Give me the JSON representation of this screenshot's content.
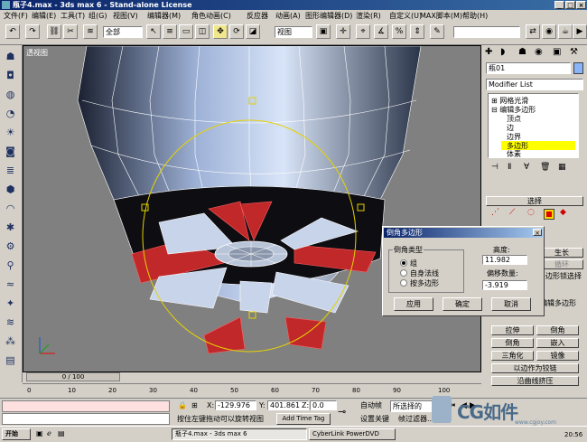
{
  "window": {
    "title": "瓶子4.max - 3ds max 6 - Stand-alone License"
  },
  "menu": [
    "文件(F)",
    "编辑(E)",
    "工具(T)",
    "组(G)",
    "视图(V)",
    "编辑器(M)",
    "角色动画(C)",
    "反应器",
    "动画(A)",
    "图形编辑器(D)",
    "渲染(R)",
    "自定义(U)",
    "MAX脚本(M)",
    "帮助(H)"
  ],
  "toolbar": {
    "selection_filter": "全部",
    "ref_coord": "视图"
  },
  "viewport": {
    "label": "透视图"
  },
  "right_panel": {
    "object_name": "瓶01",
    "modifier_list": "Modifier List",
    "stack": [
      "网格光滑",
      "编辑多边形",
      "顶点",
      "边",
      "边界",
      "多边形",
      "体素"
    ],
    "selected_stack_item": "多边形",
    "rollout_select": "选择",
    "edit_buttons": [
      "生长",
      "循环",
      "多边形锁选择"
    ],
    "bottom_buttons": [
      [
        "拉伸",
        "倒角"
      ],
      [
        "倒角",
        "嵌入"
      ],
      [
        "三角化",
        "镜像"
      ]
    ],
    "hinge_button": "以边作为铰链",
    "spline_button": "沿曲线挤压",
    "partial_label": "编辑多边形",
    "face_label": "多边形"
  },
  "dialog": {
    "title": "倒角多边形",
    "group_label": "倒角类型",
    "options": [
      "组",
      "自身法线",
      "按多边形"
    ],
    "selected_option": "组",
    "height_label": "高度:",
    "height_value": "11.982",
    "outline_label": "偏移数量:",
    "outline_value": "-3.919",
    "buttons": [
      "应用",
      "确定",
      "取消"
    ]
  },
  "timeline": {
    "frame_display": "0 / 100",
    "ticks": [
      "0",
      "10",
      "20",
      "30",
      "40",
      "50",
      "60",
      "70",
      "80",
      "90",
      "100"
    ]
  },
  "status": {
    "x_label": "X:",
    "x_value": "-129.976",
    "y_label": "Y:",
    "y_value": "401.861",
    "z_label": "Z:",
    "z_value": "0.0",
    "prompt": "按住左键拖动可以旋转视图",
    "add_time_tag": "Add Time Tag",
    "auto_key": "自动帧",
    "set_key": "设置关键",
    "selected_dropdown": "所选择的",
    "key_filters": "帧过滤器..."
  },
  "taskbar": {
    "start": "开始",
    "tasks": [
      "瓶子4.max - 3ds max 6",
      "CyberLink PowerDVD"
    ],
    "clock": "20:56"
  },
  "watermark": {
    "text": "CG如件",
    "url": "www.cgjoy.com"
  }
}
